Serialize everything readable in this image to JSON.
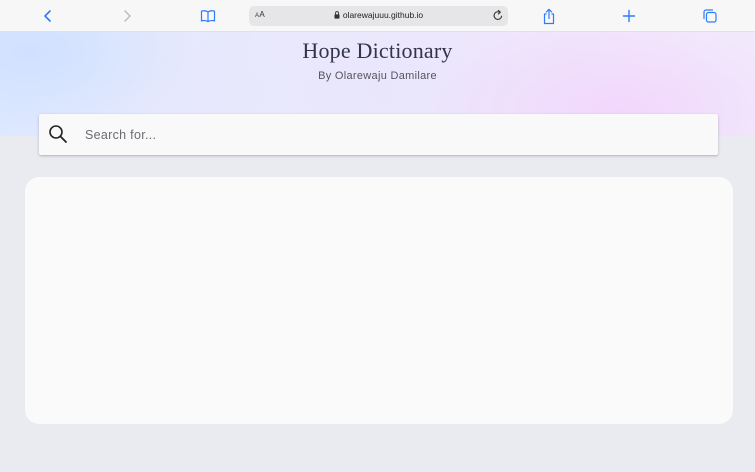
{
  "browser": {
    "icons": {
      "back": "chevron-left-icon",
      "forward": "chevron-right-icon",
      "bookmarks": "book-icon",
      "share": "share-icon",
      "new_tab": "plus-icon",
      "tabs": "tabs-icon",
      "reload": "reload-icon",
      "lock": "lock-icon"
    },
    "reader_label": "AA",
    "url": "olarewajuuu.github.io",
    "accent_color": "#2f7cf6"
  },
  "header": {
    "title": "Hope Dictionary",
    "subtitle": "By Olarewaju Damilare"
  },
  "search": {
    "placeholder": "Search for...",
    "value": ""
  },
  "results": {
    "content": ""
  }
}
